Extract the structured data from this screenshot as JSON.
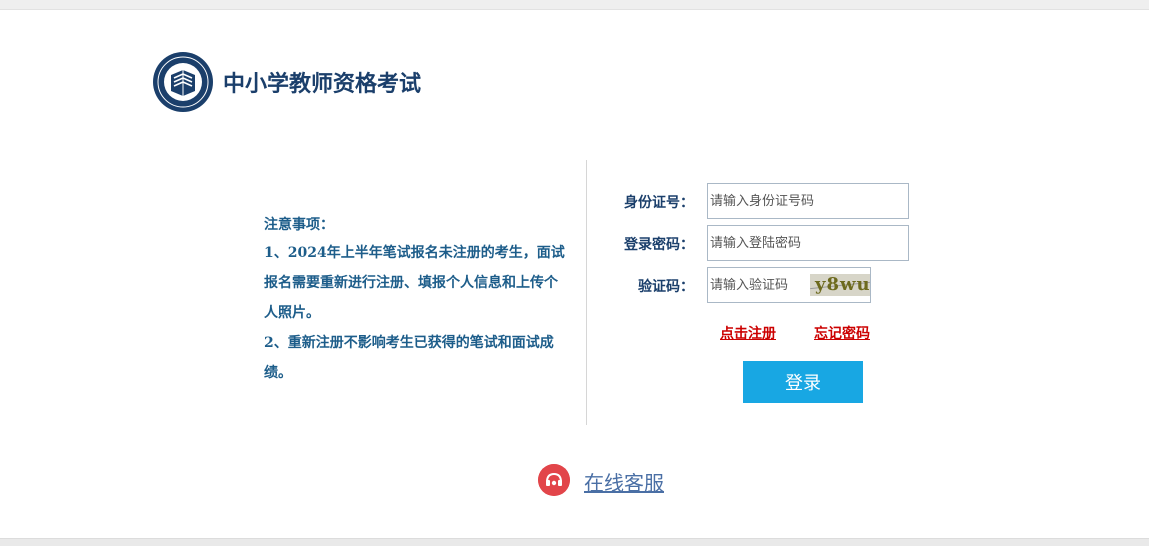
{
  "header": {
    "site_title": "中小学教师资格考试",
    "logo_icon": "teacher-qualification-emblem",
    "logo_color": "#1b3f6b"
  },
  "notice": {
    "title": "注意事项：",
    "lines": [
      "1、2024年上半年笔试报名未注册的考生，面试",
      "报名需要重新进行注册、填报个人信息和上传个",
      "人照片。",
      "2、重新注册不影响考生已获得的笔试和面试成",
      "绩。"
    ]
  },
  "login_form": {
    "id_label": "身份证号：",
    "id_placeholder": "请输入身份证号码",
    "password_label": "登录密码：",
    "password_placeholder": "请输入登陆密码",
    "captcha_label": "验证码：",
    "captcha_placeholder": "请输入验证码",
    "captcha_text": "y8wu",
    "register_link": "点击注册",
    "forgot_link": "忘记密码",
    "login_button": "登录"
  },
  "support": {
    "label": "在线客服",
    "icon": "customer-service-icon"
  },
  "colors": {
    "accent": "#18a7e3",
    "link_red": "#cc0000",
    "text_blue": "#1d5d8a"
  }
}
